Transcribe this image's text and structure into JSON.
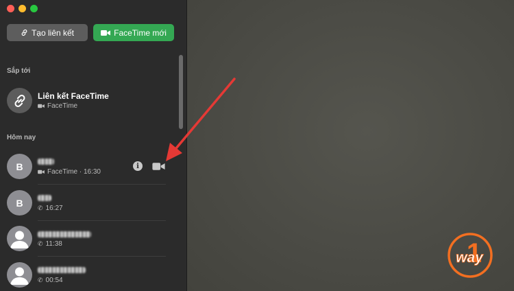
{
  "toolbar": {
    "create_link_label": "Tạo liên kết",
    "new_facetime_label": "FaceTime mới"
  },
  "sections": {
    "upcoming": "Sắp tới",
    "today": "Hôm nay"
  },
  "upcoming_item": {
    "title": "Liên kết FaceTime",
    "subtitle": "FaceTime",
    "icon": "link-icon"
  },
  "calls": [
    {
      "avatar": "B",
      "detail": "FaceTime · 16:30",
      "type": "video"
    },
    {
      "avatar": "B",
      "detail": "16:27",
      "type": "audio"
    },
    {
      "avatar": "",
      "detail": "11:38",
      "type": "audio"
    },
    {
      "avatar": "",
      "detail": "00:54",
      "type": "audio"
    }
  ],
  "colors": {
    "sidebar_bg": "#2b2b2b",
    "accent_green": "#34a853",
    "arrow_red": "#e53935",
    "logo_orange": "#f36f21"
  },
  "watermark": {
    "text": "way",
    "digit": "1"
  }
}
